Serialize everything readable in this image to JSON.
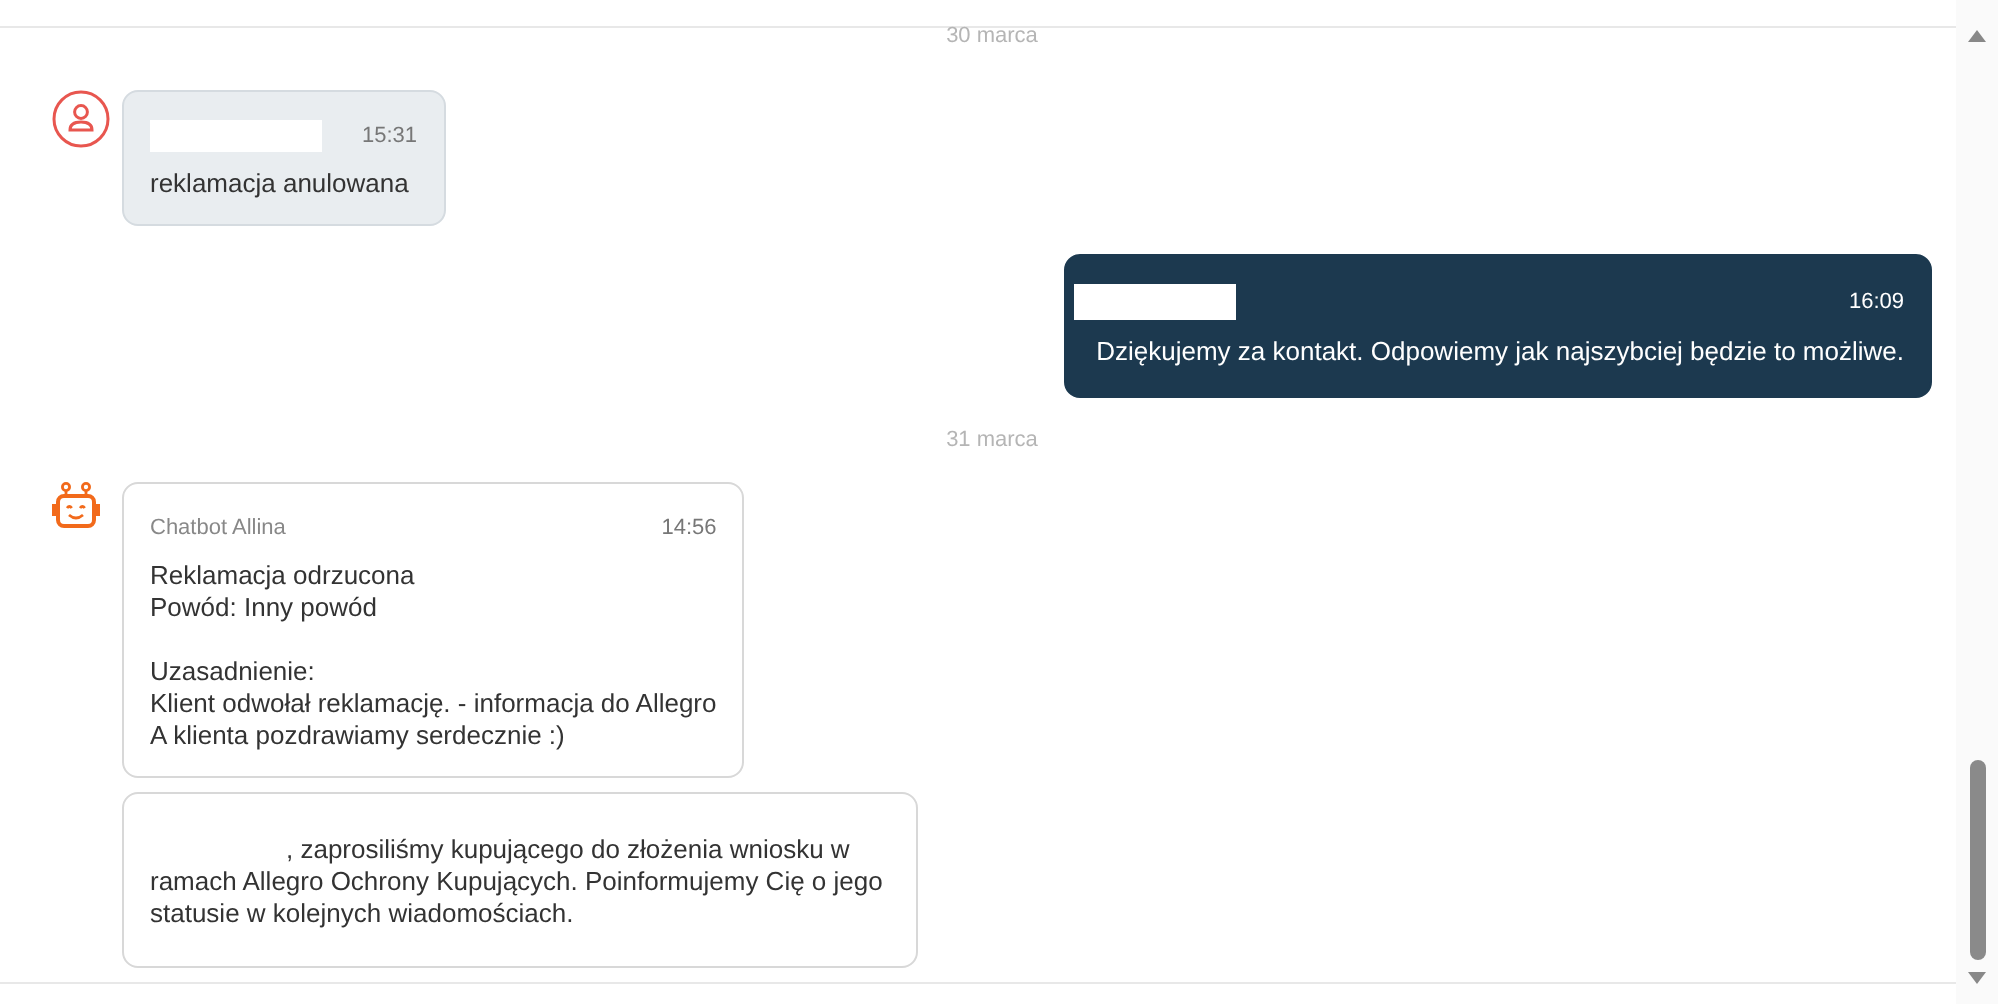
{
  "thread": [
    {
      "kind": "date",
      "text": "30 marca"
    },
    {
      "kind": "incoming",
      "avatar": {
        "kind": "person"
      },
      "redacted_author": true,
      "time": "15:31",
      "body": "reklamacja anulowana"
    },
    {
      "kind": "outgoing",
      "redacted_author": true,
      "time": "16:09",
      "body": "Dziękujemy za kontakt. Odpowiemy jak najszybciej będzie to możliwe."
    },
    {
      "kind": "date",
      "text": "31 marca"
    },
    {
      "kind": "bot",
      "avatar": {
        "kind": "robot"
      },
      "author": "Chatbot Allina",
      "time": "14:56",
      "body": "Reklamacja odrzucona\nPowód: Inny powód\n\nUzasadnienie:\nKlient odwołał reklamację. - informacja do Allegro\nA klienta pozdrawiamy serdecznie :)"
    },
    {
      "kind": "bot",
      "redacted_prefix": true,
      "body": ", zaprosiliśmy kupującego do złożenia wniosku w ramach Allegro Ochrony Kupujących. Poinformujemy Cię o jego statusie w kolejnych wiadomościach."
    }
  ]
}
